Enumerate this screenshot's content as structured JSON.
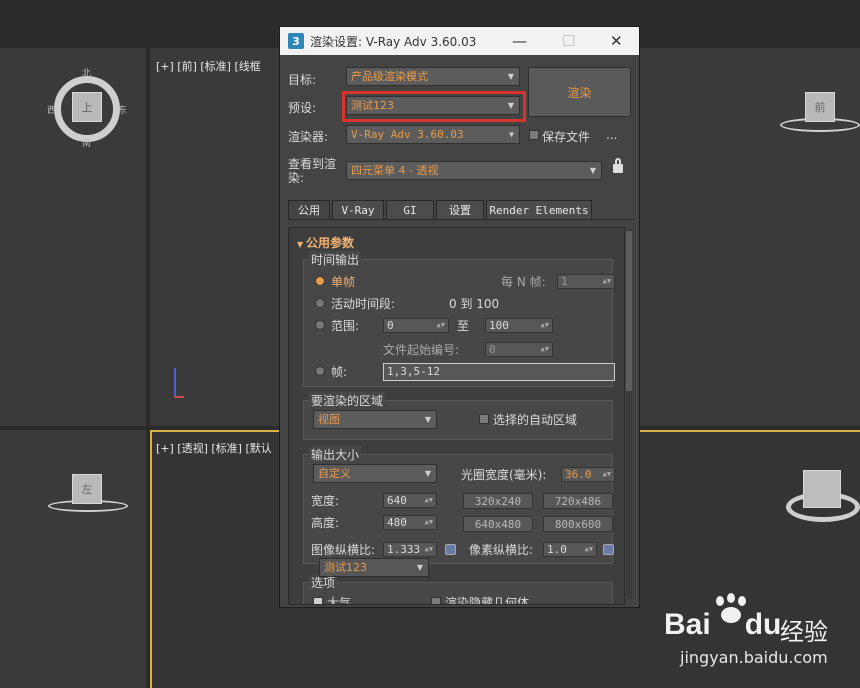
{
  "viewports": {
    "top_left_label": "",
    "top_center_label": "[+] [前] [标准] [线框",
    "bottom_center_label": "[+] [透视] [标准] [默认",
    "top_cube_label": "上",
    "front_cube_label": "前",
    "left_cube_label": "左",
    "compass": {
      "north": "北",
      "south": "南",
      "west": "西",
      "east": "东"
    }
  },
  "dialog": {
    "app_icon": "3",
    "title": "渲染设置: V-Ray Adv 3.60.03",
    "minimize": "—",
    "maximize": "☐",
    "close": "✕",
    "target_label": "目标:",
    "target_value": "产品级渲染模式",
    "preset_label": "预设:",
    "preset_value": "测试123",
    "renderer_label": "渲染器:",
    "renderer_value": "V-Ray Adv 3.60.03",
    "save_file_label": "保存文件",
    "more": "...",
    "view_label": "查看到渲染:",
    "view_value": "四元菜单 4 - 透视",
    "render_button": "渲染",
    "tabs": [
      "公用",
      "V-Ray",
      "GI",
      "设置",
      "Render Elements"
    ],
    "rollout_title": "公用参数",
    "time_output": {
      "title": "时间输出",
      "single": "单帧",
      "every_n_label": "每 N 帧:",
      "every_n_value": "1",
      "active_segment": "活动时间段:",
      "active_range": "0 到 100",
      "range": "范围:",
      "range_from": "0",
      "range_to_word": "至",
      "range_to": "100",
      "file_start_label": "文件起始编号:",
      "file_start_value": "0",
      "frames": "帧:",
      "frames_value": "1,3,5-12"
    },
    "area": {
      "title": "要渲染的区域",
      "view_value": "视图",
      "auto_region": "选择的自动区域"
    },
    "output_size": {
      "title": "输出大小",
      "custom": "自定义",
      "aperture_label": "光圈宽度(毫米):",
      "aperture_value": "36.0",
      "width_label": "宽度:",
      "width_value": "640",
      "height_label": "高度:",
      "height_value": "480",
      "presets": [
        "320x240",
        "720x486",
        "640x480",
        "800x600"
      ],
      "image_aspect_label": "图像纵横比:",
      "image_aspect_value": "1.333",
      "pixel_aspect_label": "像素纵横比:",
      "pixel_aspect_value": "1.0"
    },
    "options": {
      "title": "选项",
      "atmosphere": "大气",
      "hidden_geo": "渲染隐藏几何体"
    },
    "preset_popup": "测试123"
  },
  "watermark": {
    "brand": "Bai",
    "brand2": "du",
    "cn": "经验",
    "url": "jingyan.baidu.com"
  },
  "colors": {
    "highlight": "#d9342b",
    "accent": "#e89b4c"
  }
}
